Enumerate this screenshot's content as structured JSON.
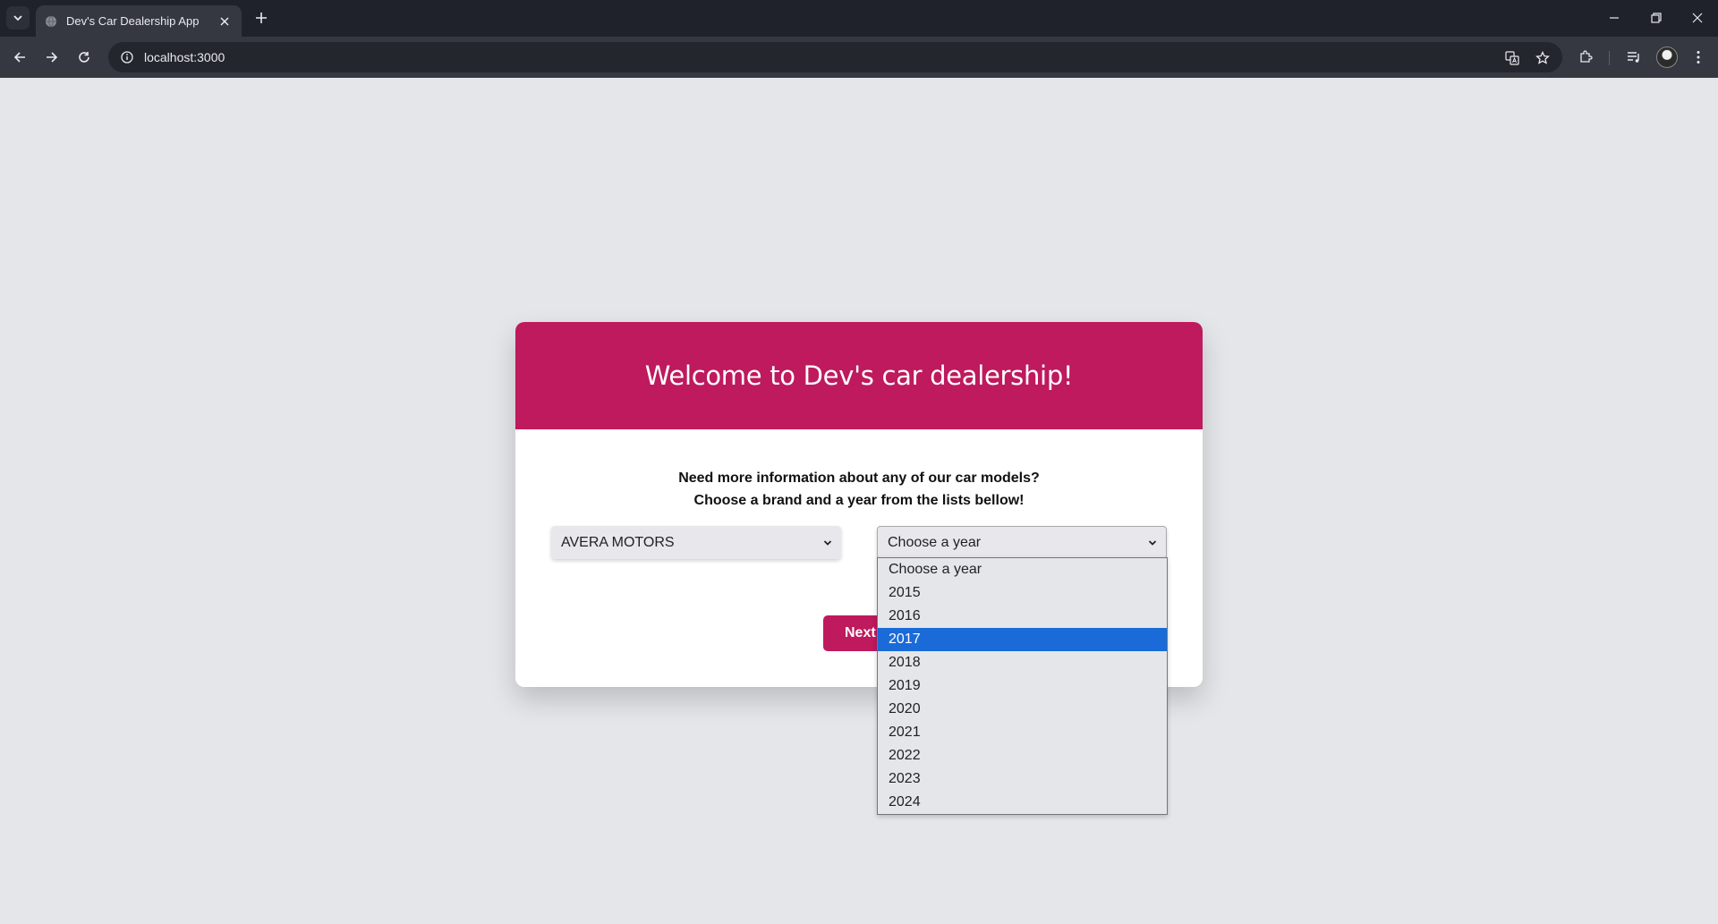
{
  "browser": {
    "tab_title": "Dev's Car Dealership App",
    "url": "localhost:3000"
  },
  "page": {
    "header_title": "Welcome to Dev's car dealership!",
    "intro_line1": "Need more information about any of our car models?",
    "intro_line2": "Choose a brand and a year from the lists bellow!",
    "brand_select_value": "AVERA MOTORS",
    "year_select_value": "Choose a year",
    "next_button_label": "Next",
    "year_options": [
      "Choose a year",
      "2015",
      "2016",
      "2017",
      "2018",
      "2019",
      "2020",
      "2021",
      "2022",
      "2023",
      "2024"
    ],
    "highlighted_year": "2017"
  },
  "colors": {
    "accent": "#be1a5d",
    "page_background": "#e5e6ea",
    "option_highlight": "#1a6bd8"
  },
  "icons": [
    "tab-list-icon",
    "globe-icon",
    "close-icon",
    "plus-icon",
    "minimize-icon",
    "restore-icon",
    "back-icon",
    "forward-icon",
    "reload-icon",
    "info-icon",
    "translate-icon",
    "star-icon",
    "extensions-icon",
    "media-icon",
    "menu-icon",
    "chevron-down-icon"
  ]
}
